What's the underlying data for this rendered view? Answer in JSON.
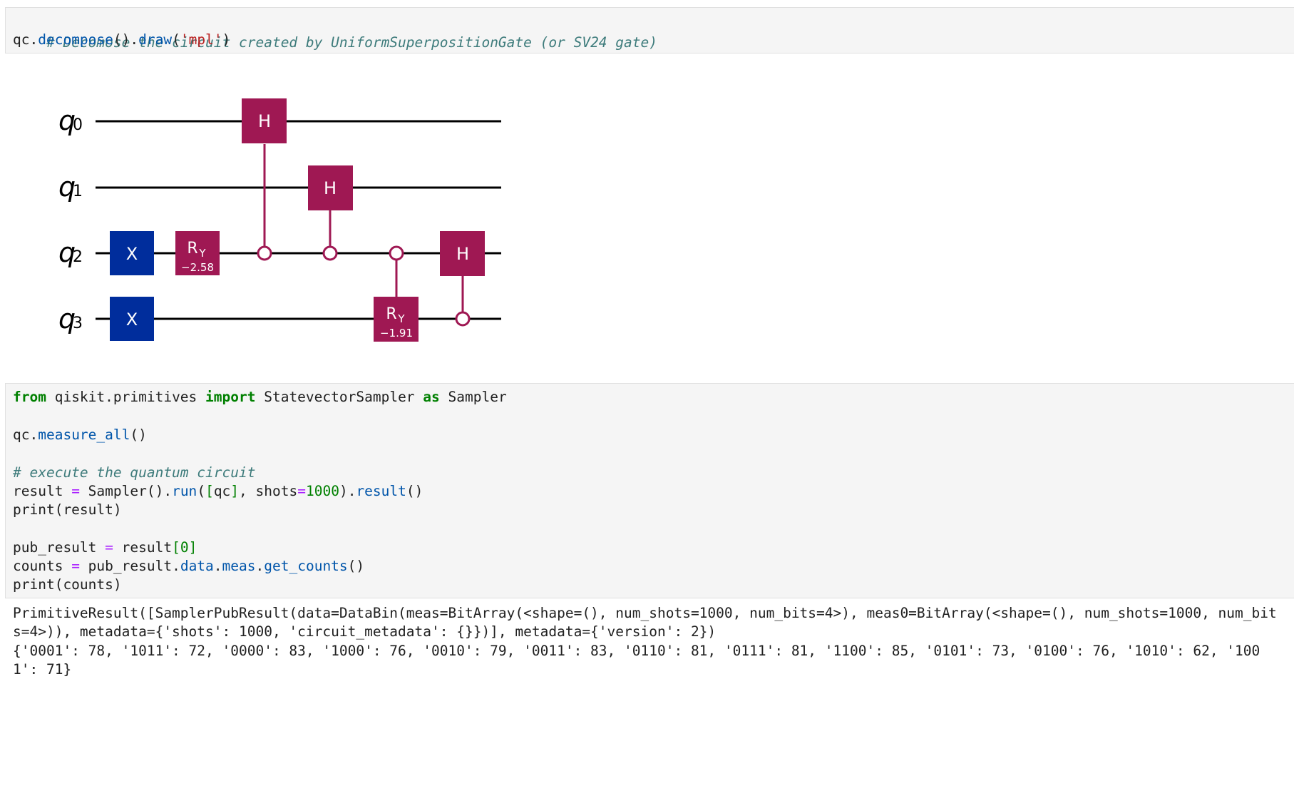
{
  "cell1": {
    "comment": "# Decomose the circuit created by UniformSuperpositionGate (or SV24 gate)",
    "code_obj": "qc",
    "code_fn1": "decompose",
    "code_fn2": "draw",
    "code_arg": "'mpl'"
  },
  "circuit": {
    "qubits": [
      "q0",
      "q1",
      "q2",
      "q3"
    ],
    "qubit_base": [
      "q",
      "q",
      "q",
      "q"
    ],
    "qubit_sub": [
      "0",
      "1",
      "2",
      "3"
    ],
    "gates": {
      "x_label": "X",
      "h_label": "H",
      "ry_label": "R",
      "ry_sub": "Y",
      "ry1_param": "−2.58",
      "ry2_param": "−1.91"
    },
    "colors": {
      "x_gate": "#002d9c",
      "controlled_gate": "#9f1853",
      "wire": "#000000"
    }
  },
  "cell2": {
    "l1_from": "from",
    "l1_mod": " qiskit.primitives ",
    "l1_import": "import",
    "l1_cls": " StatevectorSampler ",
    "l1_as": "as",
    "l1_alias": " Sampler",
    "l3_obj": "qc.",
    "l3_fn": "measure_all",
    "l3_paren": "()",
    "l5_comment": "# execute the quantum circuit",
    "l6_a": "result ",
    "l6_eq": "=",
    "l6_b": " Sampler().",
    "l6_run": "run",
    "l6_c": "(",
    "l6_br1": "[",
    "l6_d": "qc",
    "l6_br2": "]",
    "l6_e": ", shots",
    "l6_eq2": "=",
    "l6_num": "1000",
    "l6_f": ").",
    "l6_res": "result",
    "l6_g": "()",
    "l7": "print(result)",
    "l9_a": "pub_result ",
    "l9_eq": "=",
    "l9_b": " result",
    "l9_br1": "[",
    "l9_num": "0",
    "l9_br2": "]",
    "l10_a": "counts ",
    "l10_eq": "=",
    "l10_b": " pub_result.",
    "l10_data": "data",
    "l10_dot1": ".",
    "l10_meas": "meas",
    "l10_dot2": ".",
    "l10_gc": "get_counts",
    "l10_paren": "()",
    "l11": "print(counts)"
  },
  "output": {
    "line1": "PrimitiveResult([SamplerPubResult(data=DataBin(meas=BitArray(<shape=(), num_shots=1000, num_bits=4>), meas0=BitArray(<shape=(), num_shots=1000, num_bit",
    "line2": "s=4>)), metadata={'shots': 1000, 'circuit_metadata': {}})], metadata={'version': 2})",
    "line3": "{'0001': 78, '1011': 72, '0000': 83, '1000': 76, '0010': 79, '0011': 83, '0110': 81, '0111': 81, '1100': 85, '0101': 73, '0100': 76, '1010': 62, '100",
    "line4": "1': 71}"
  }
}
